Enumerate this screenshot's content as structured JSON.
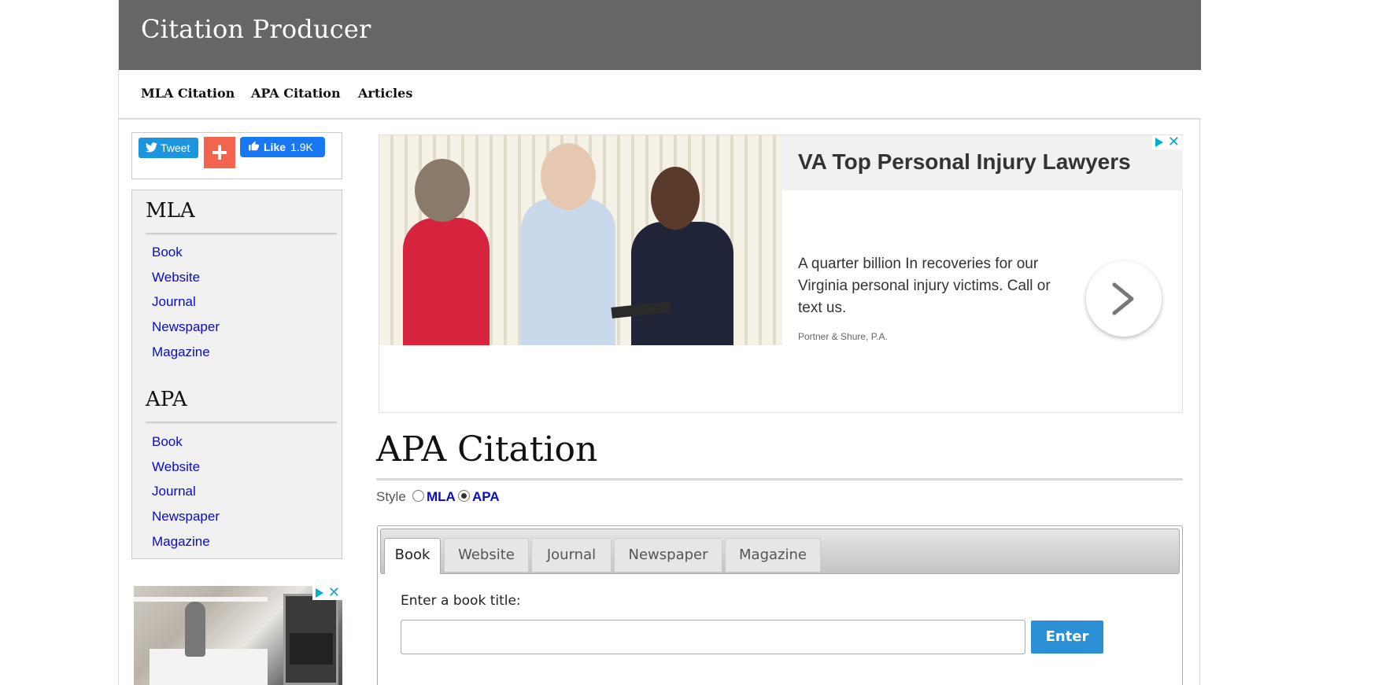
{
  "site": {
    "title": "Citation Producer"
  },
  "nav": {
    "items": [
      "MLA Citation",
      "APA Citation",
      "Articles"
    ]
  },
  "social": {
    "tweet_label": "Tweet",
    "plus_label": "+",
    "like_label": "Like",
    "like_count": "1.9K"
  },
  "sidebar": {
    "sections": [
      {
        "heading": "MLA",
        "links": [
          "Book",
          "Website",
          "Journal",
          "Newspaper",
          "Magazine"
        ]
      },
      {
        "heading": "APA",
        "links": [
          "Book",
          "Website",
          "Journal",
          "Newspaper",
          "Magazine"
        ]
      }
    ]
  },
  "ad": {
    "headline": "VA Top Personal Injury Lawyers",
    "body": "A quarter billion In recoveries for our Virginia personal injury victims. Call or text us.",
    "source": "Portner & Shure, P.A."
  },
  "main": {
    "title": "APA Citation",
    "style_label": "Style",
    "style_options": [
      {
        "label": "MLA",
        "selected": false
      },
      {
        "label": "APA",
        "selected": true
      }
    ],
    "tabs": [
      {
        "label": "Book",
        "active": true
      },
      {
        "label": "Website",
        "active": false
      },
      {
        "label": "Journal",
        "active": false
      },
      {
        "label": "Newspaper",
        "active": false
      },
      {
        "label": "Magazine",
        "active": false
      }
    ],
    "field_label": "Enter a book title:",
    "field_value": "",
    "enter_label": "Enter"
  },
  "colors": {
    "header_bg": "#666666",
    "link": "#0a0acc",
    "enter_button": "#2b8fd6",
    "tweet": "#1b95e0",
    "like": "#1877f2",
    "plus": "#f2644f"
  },
  "icons": [
    "twitter-bird-icon",
    "thumbs-up-icon",
    "adchoices-icon",
    "close-icon",
    "chevron-right-icon"
  ]
}
